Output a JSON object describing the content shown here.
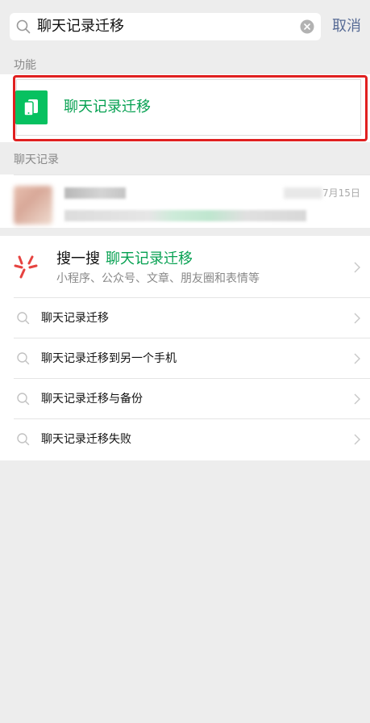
{
  "search": {
    "query": "聊天记录迁移",
    "cancel_label": "取消"
  },
  "sections": {
    "functions_label": "功能",
    "records_label": "聊天记录"
  },
  "function_result": {
    "title": "聊天记录迁移",
    "icon": "phone-transfer-icon",
    "accent": "#07c160"
  },
  "chat_record": {
    "date": "7月15日"
  },
  "souyisou": {
    "title": "搜一搜",
    "keyword": "聊天记录迁移",
    "description": "小程序、公众号、文章、朋友圈和表情等",
    "icon": "souyisou-icon"
  },
  "suggestions": [
    "聊天记录迁移",
    "聊天记录迁移到另一个手机",
    "聊天记录迁移与备份",
    "聊天记录迁移失败"
  ],
  "colors": {
    "link": "#576b95",
    "highlight": "#07a152",
    "annotation": "#e02020"
  }
}
